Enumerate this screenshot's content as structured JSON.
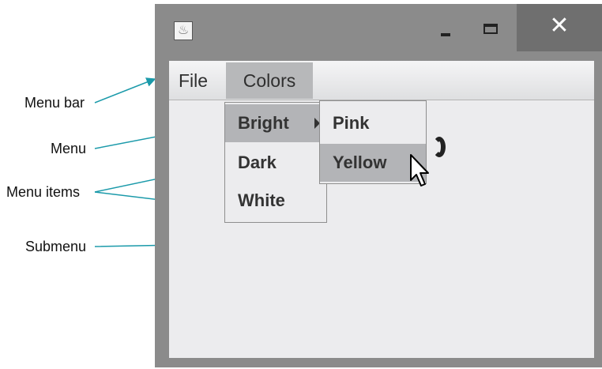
{
  "window": {
    "app_icon": "java-cup-icon",
    "controls": [
      "minimize-icon",
      "maximize-icon",
      "close-icon"
    ],
    "close_glyph": "✕"
  },
  "menubar": {
    "items": [
      {
        "label": "File"
      },
      {
        "label": "Colors"
      }
    ]
  },
  "colors_menu": {
    "items": [
      {
        "label": "Bright"
      },
      {
        "label": "Dark"
      },
      {
        "label": "White"
      }
    ]
  },
  "bright_submenu": {
    "items": [
      {
        "label": "Pink"
      },
      {
        "label": "Yellow"
      }
    ]
  },
  "callouts": {
    "menu_bar": "Menu bar",
    "menu": "Menu",
    "menu_items": "Menu items",
    "submenu": "Submenu"
  },
  "colors": {
    "arrow": "#1b9aaa",
    "selected": "#b3b4b7",
    "frame": "#8b8b8b"
  }
}
